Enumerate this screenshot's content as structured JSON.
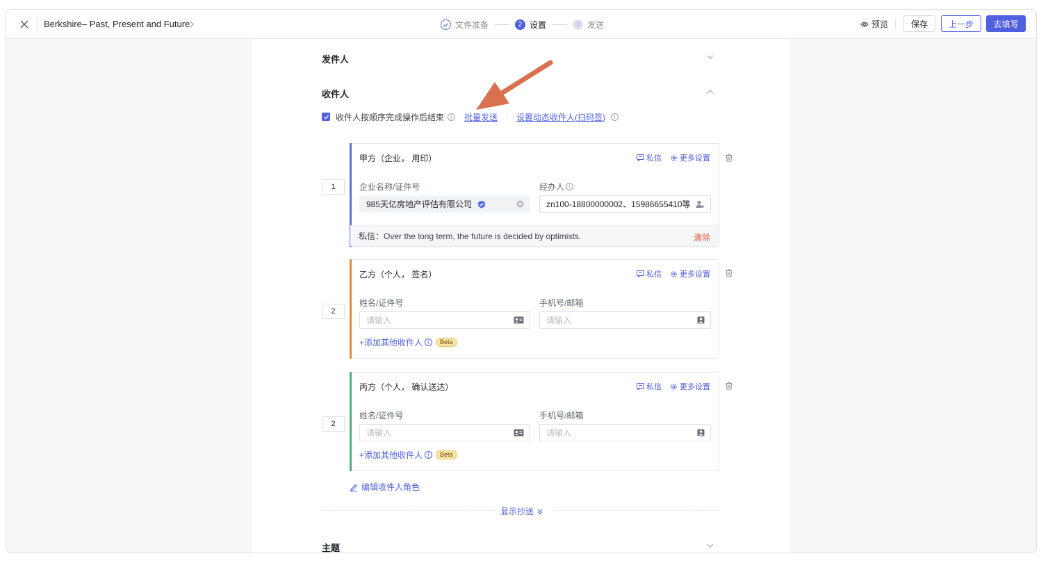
{
  "header": {
    "title": "Berkshire– Past, Present and Future",
    "steps": [
      {
        "num": "",
        "label": "文件准备",
        "state": "done"
      },
      {
        "num": "2",
        "label": "设置",
        "state": "active"
      },
      {
        "num": "3",
        "label": "发送",
        "state": "todo"
      }
    ],
    "preview_label": "预览",
    "save_label": "保存",
    "prev_label": "上一步",
    "fill_label": "去填写"
  },
  "sections": {
    "sender": "发件人",
    "recipients": "收件人",
    "subject": "主题"
  },
  "options": {
    "sequential_label": "收件人按顺序完成操作后结束",
    "batch_send": "批量发送",
    "dynamic_recipient": "设置动态收件人(扫码签)"
  },
  "recipients": [
    {
      "order": "1",
      "role": "甲方（企业， 用印）",
      "color": "#5b6ee1",
      "private_msg_label": "私信",
      "more_settings_label": "更多设置",
      "field1_label": "企业名称/证件号",
      "field1_value": "985天亿房地产评估有限公司",
      "field2_label": "经办人",
      "field2_value": "zn100-18800000002、15986655410等",
      "message_text": "私信：Over the long term, the future is decided by optimists.",
      "clear_label": "清除"
    },
    {
      "order": "2",
      "role": "乙方（个人， 签名）",
      "color": "#e08a3c",
      "private_msg_label": "私信",
      "more_settings_label": "更多设置",
      "field1_label": "姓名/证件号",
      "field1_placeholder": "请输入",
      "field2_label": "手机号/邮箱",
      "field2_placeholder": "请输入",
      "add_more": "+添加其他收件人",
      "beta": "Beta"
    },
    {
      "order": "2",
      "role": "丙方（个人， 确认送达）",
      "color": "#4caf7a",
      "private_msg_label": "私信",
      "more_settings_label": "更多设置",
      "field1_label": "姓名/证件号",
      "field1_placeholder": "请输入",
      "field2_label": "手机号/邮箱",
      "field2_placeholder": "请输入",
      "add_more": "+添加其他收件人",
      "beta": "Beta"
    }
  ],
  "edit_roles_label": "编辑收件人角色",
  "show_cc_label": "显示抄送",
  "colors": {
    "accent": "#4f5fe0",
    "annotation_arrow": "#d9714f",
    "clear": "#e0553a"
  }
}
